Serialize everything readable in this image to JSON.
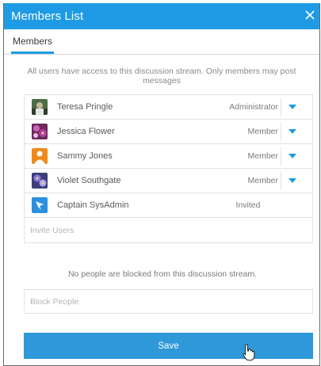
{
  "dialog": {
    "title": "Members List",
    "tab_label": "Members",
    "info_text": "All users have access to this discussion stream. Only members may post messages",
    "members": [
      {
        "name": "Teresa Pringle",
        "role": "Administrator",
        "has_dropdown": true,
        "avatar": "photo-avatar"
      },
      {
        "name": "Jessica Flower",
        "role": "Member",
        "has_dropdown": true,
        "avatar": "flower-avatar"
      },
      {
        "name": "Sammy Jones",
        "role": "Member",
        "has_dropdown": true,
        "avatar": "orange-avatar"
      },
      {
        "name": "Violet Southgate",
        "role": "Member",
        "has_dropdown": true,
        "avatar": "violet-avatar"
      },
      {
        "name": "Captain SysAdmin",
        "role": "Invited",
        "has_dropdown": false,
        "avatar": "bird-avatar"
      }
    ],
    "invite_placeholder": "Invite Users",
    "blocked_text": "No people are blocked from this discussion stream.",
    "block_placeholder": "Block People",
    "save_label": "Save"
  },
  "colors": {
    "accent": "#1e9be4",
    "save_button": "#2f98d8"
  }
}
